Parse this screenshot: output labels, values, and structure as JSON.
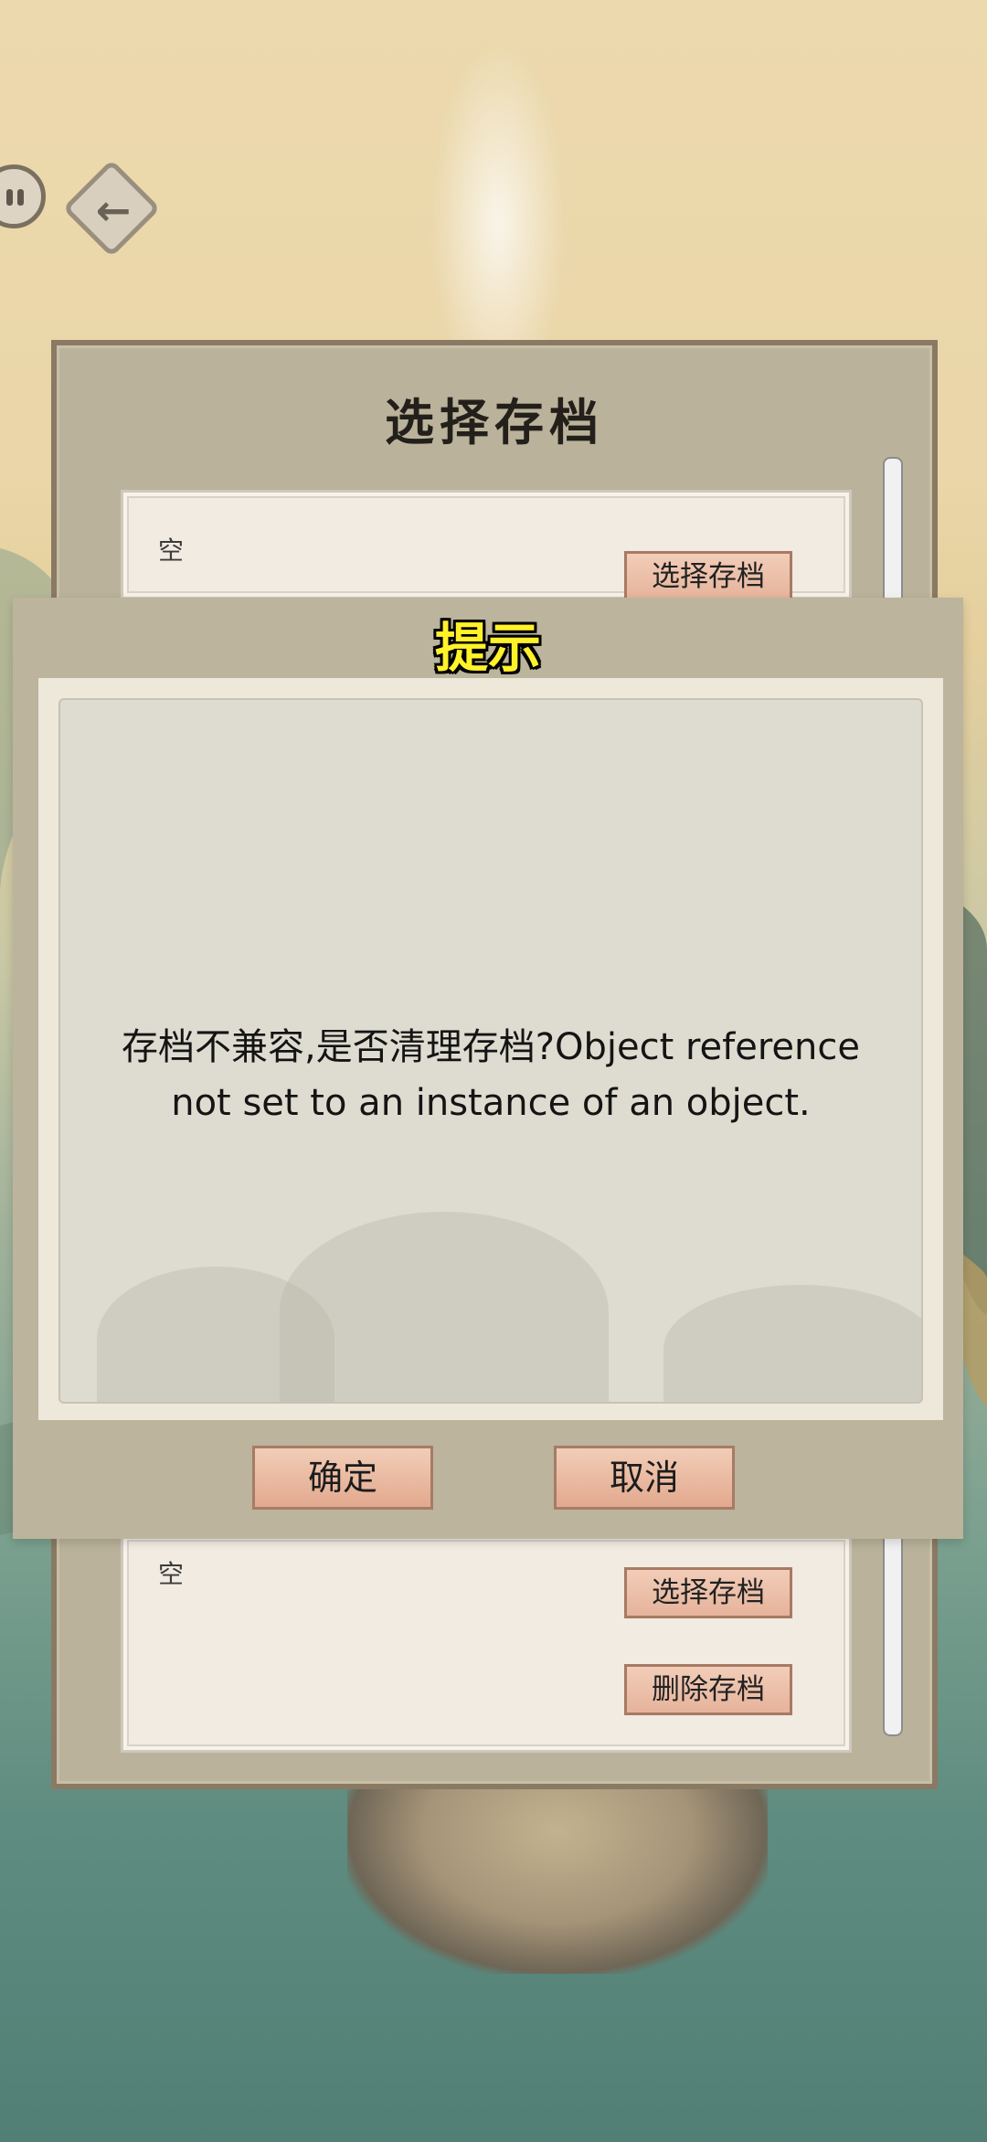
{
  "background": {
    "scene": "ink-wash mountains and river"
  },
  "hud": {
    "pause_icon": "pause-icon",
    "back_icon": "back-arrow-icon"
  },
  "save_panel": {
    "title": "选择存档",
    "slots": [
      {
        "label": "空",
        "select_label": "选择存档"
      },
      {
        "label": "空",
        "select_label": "选择存档",
        "delete_label": "删除存档"
      }
    ]
  },
  "dialog": {
    "title": "提示",
    "message_line1": "存档不兼容,是否清理存档?Object reference",
    "message_line2": "not set to an instance of an object.",
    "confirm_label": "确定",
    "cancel_label": "取消"
  },
  "colors": {
    "panel_bg": "#bab29a",
    "button_fill": "#e6b39b",
    "title_yellow": "#fff22a"
  }
}
